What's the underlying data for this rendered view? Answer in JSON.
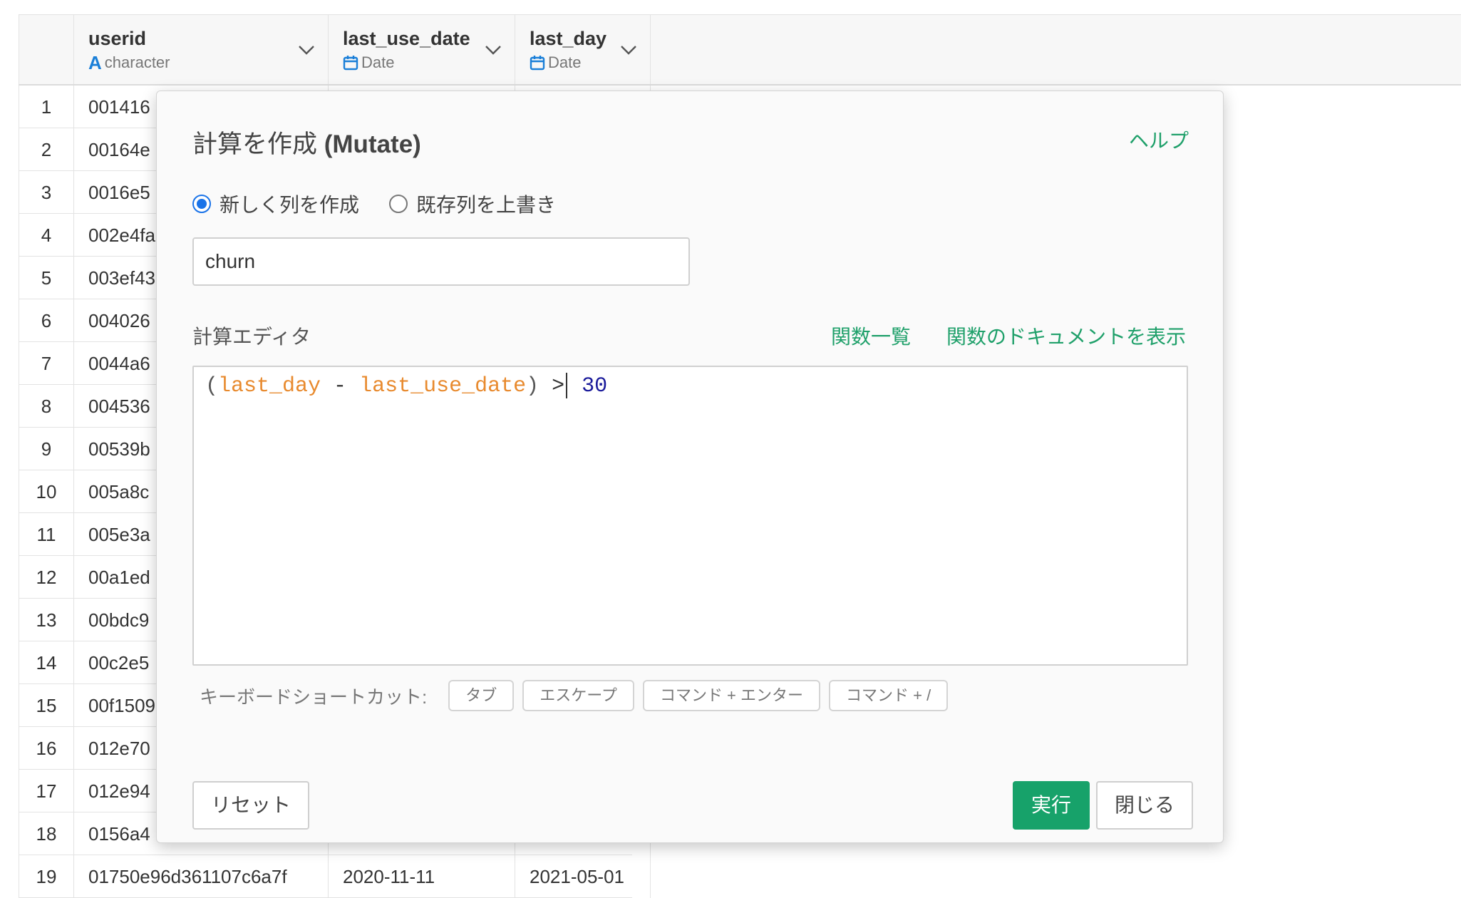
{
  "grid": {
    "columns": [
      {
        "name": "userid",
        "type": "character",
        "type_icon": "text-type-icon"
      },
      {
        "name": "last_use_date",
        "type": "Date",
        "type_icon": "calendar-icon"
      },
      {
        "name": "last_day",
        "type": "Date",
        "type_icon": "calendar-icon"
      }
    ],
    "type_letter": "A",
    "rows": [
      {
        "num": "1",
        "userid": "001416",
        "last_use_date": "",
        "last_day": ""
      },
      {
        "num": "2",
        "userid": "00164e",
        "last_use_date": "",
        "last_day": ""
      },
      {
        "num": "3",
        "userid": "0016e5",
        "last_use_date": "",
        "last_day": ""
      },
      {
        "num": "4",
        "userid": "002e4fa",
        "last_use_date": "",
        "last_day": ""
      },
      {
        "num": "5",
        "userid": "003ef43",
        "last_use_date": "",
        "last_day": ""
      },
      {
        "num": "6",
        "userid": "004026",
        "last_use_date": "",
        "last_day": ""
      },
      {
        "num": "7",
        "userid": "0044a6",
        "last_use_date": "",
        "last_day": ""
      },
      {
        "num": "8",
        "userid": "004536",
        "last_use_date": "",
        "last_day": ""
      },
      {
        "num": "9",
        "userid": "00539b",
        "last_use_date": "",
        "last_day": ""
      },
      {
        "num": "10",
        "userid": "005a8c",
        "last_use_date": "",
        "last_day": ""
      },
      {
        "num": "11",
        "userid": "005e3a",
        "last_use_date": "",
        "last_day": ""
      },
      {
        "num": "12",
        "userid": "00a1ed",
        "last_use_date": "",
        "last_day": ""
      },
      {
        "num": "13",
        "userid": "00bdc9",
        "last_use_date": "",
        "last_day": ""
      },
      {
        "num": "14",
        "userid": "00c2e5",
        "last_use_date": "",
        "last_day": ""
      },
      {
        "num": "15",
        "userid": "00f1509",
        "last_use_date": "",
        "last_day": ""
      },
      {
        "num": "16",
        "userid": "012e70",
        "last_use_date": "",
        "last_day": ""
      },
      {
        "num": "17",
        "userid": "012e94",
        "last_use_date": "",
        "last_day": ""
      },
      {
        "num": "18",
        "userid": "0156a4",
        "last_use_date": "",
        "last_day": ""
      },
      {
        "num": "19",
        "userid": "01750e96d361107c6a7f",
        "last_use_date": "2020-11-11",
        "last_day": "2021-05-01"
      }
    ]
  },
  "dialog": {
    "title_ja": "計算を作成",
    "title_en": "(Mutate)",
    "help_label": "ヘルプ",
    "radio_new": "新しく列を作成",
    "radio_overwrite": "既存列を上書き",
    "selected_mode": "new",
    "column_name_value": "churn",
    "editor_label": "計算エディタ",
    "function_list_link": "関数一覧",
    "function_docs_link": "関数のドキュメントを表示",
    "expression": {
      "open_paren": "(",
      "col1": "last_day",
      "minus": " - ",
      "col2": "last_use_date",
      "close_paren": ")",
      "gt": " >",
      "num": " 30"
    },
    "shortcuts_label": "キーボードショートカット:",
    "shortcuts": [
      "タブ",
      "エスケープ",
      "コマンド + エンター",
      "コマンド + /"
    ],
    "reset_label": "リセット",
    "run_label": "実行",
    "close_label": "閉じる"
  },
  "colors": {
    "accent_green": "#17a26a",
    "link_green": "#1fa06a",
    "radio_blue": "#1a73e8",
    "column_token": "#e88a2e",
    "number_token": "#1b1b9b"
  }
}
